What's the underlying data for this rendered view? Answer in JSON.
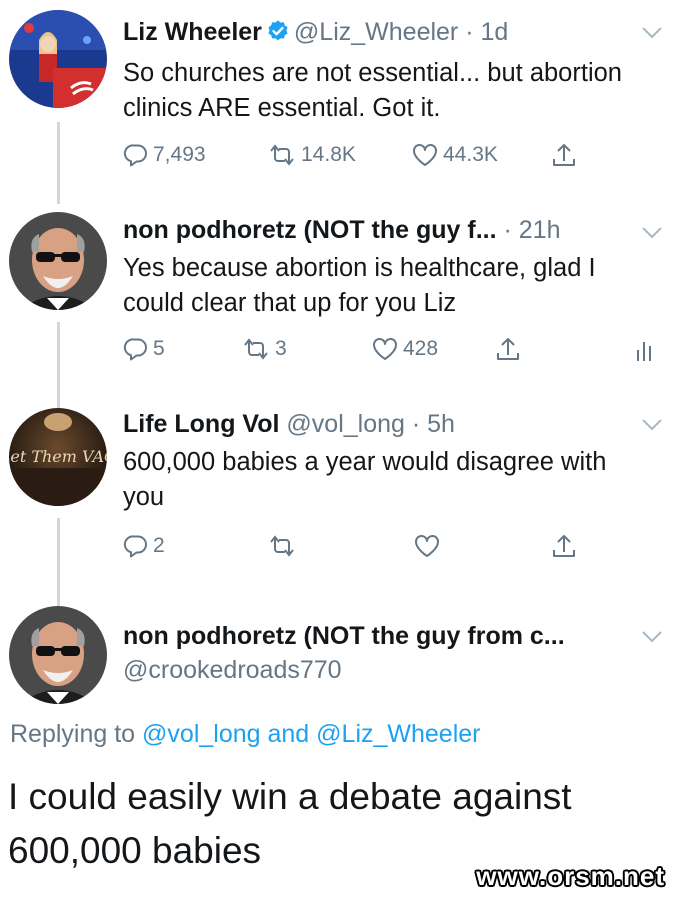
{
  "tweets": [
    {
      "name": "Liz Wheeler",
      "handle": "@Liz_Wheeler",
      "time": "1d",
      "verified": true,
      "text": "So churches are not essential... but abortion clinics ARE essential. Got it.",
      "replies": "7,493",
      "retweets": "14.8K",
      "likes": "44.3K",
      "avatar_icon": "woman-at-podium-avatar"
    },
    {
      "name": "non podhoretz (NOT the guy f...",
      "time": "21h",
      "text": "Yes because abortion is healthcare, glad I could clear that up for you Liz",
      "replies": "5",
      "retweets": "3",
      "likes": "428",
      "avatar_icon": "bald-man-sunglasses-avatar"
    },
    {
      "name": "Life Long Vol",
      "handle": "@vol_long",
      "time": "5h",
      "text": "600,000 babies a year would disagree with you",
      "replies": "2",
      "retweets": "",
      "likes": "",
      "avatar_icon": "let-them-vac-logo-avatar",
      "avatar_text": "Let Them VAC"
    },
    {
      "name": "non podhoretz (NOT the guy from c...",
      "handle": "@crookedroads770",
      "avatar_icon": "bald-man-sunglasses-avatar"
    }
  ],
  "replying": {
    "prefix": "Replying to ",
    "mention1": "@vol_long",
    "conjunction": " and ",
    "mention2": "@Liz_Wheeler"
  },
  "focused_text": "I could easily win a debate against 600,000 babies",
  "watermark": "www.orsm.net",
  "colors": {
    "accent": "#1da1f2",
    "secondary_text": "#657786",
    "primary_text": "#14171a",
    "thread_line": "#cfd6dc"
  }
}
